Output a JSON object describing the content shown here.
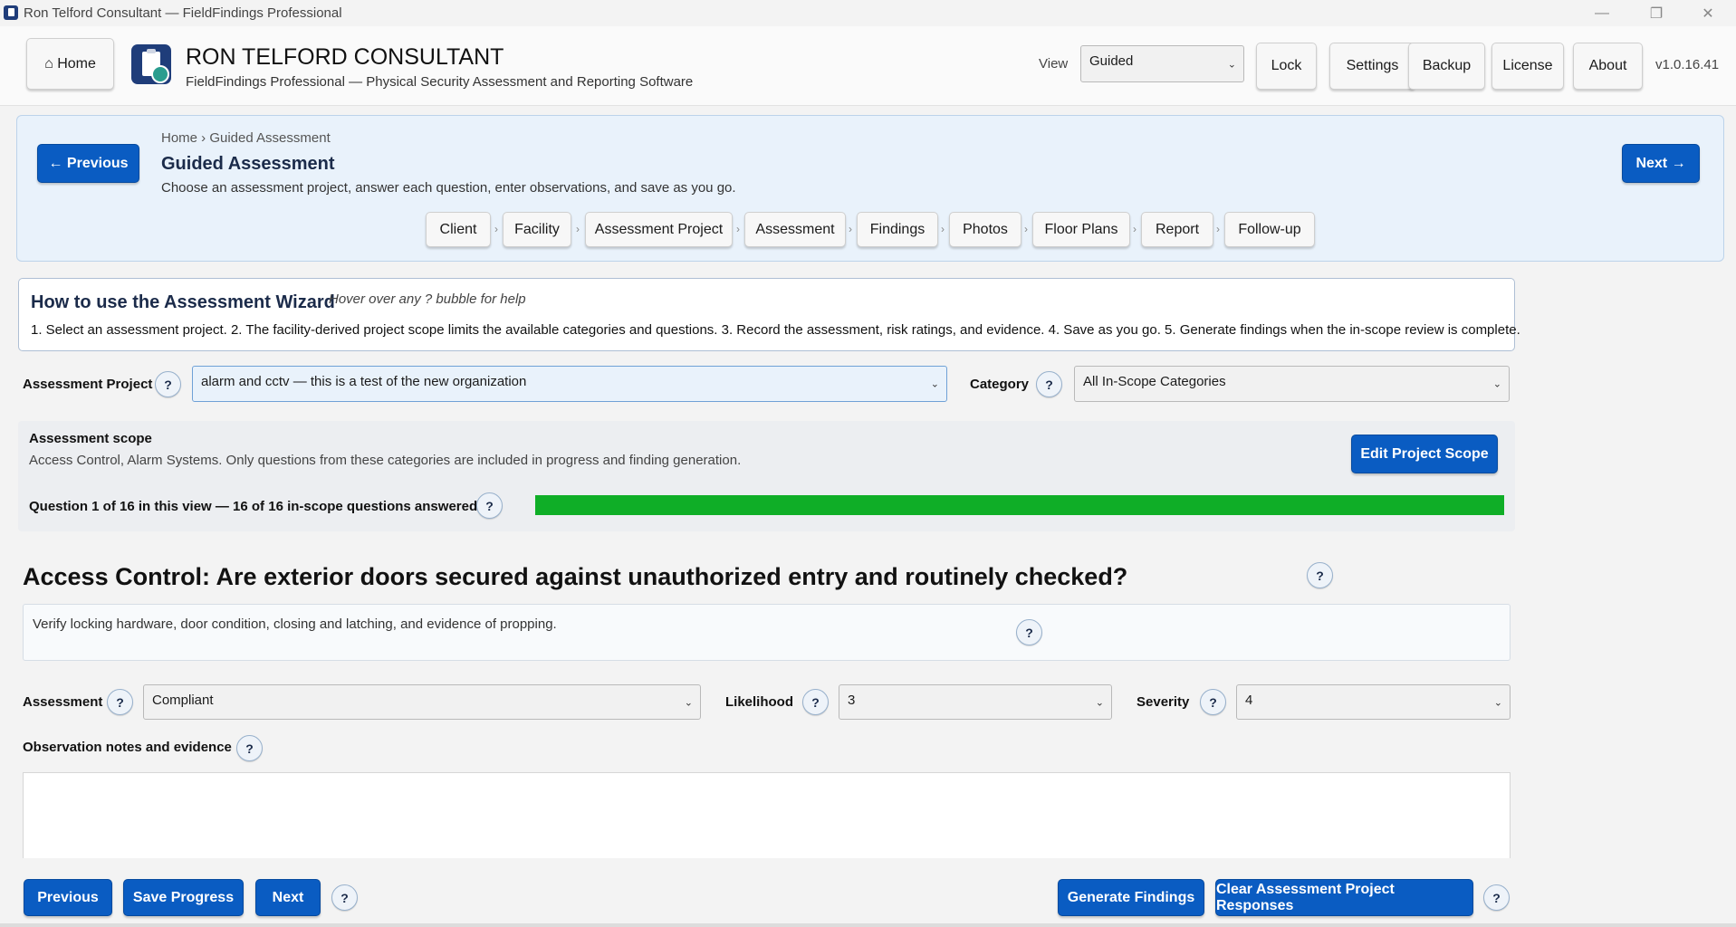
{
  "window": {
    "title": "Ron Telford Consultant — FieldFindings Professional",
    "controls": {
      "minimize": "—",
      "restore": "❐",
      "close": "✕"
    }
  },
  "header": {
    "home_label": "⌂  Home",
    "app_name": "RON TELFORD CONSULTANT",
    "app_subtitle": "FieldFindings Professional — Physical Security Assessment and Reporting Software",
    "view_label": "View",
    "view_value": "Guided",
    "buttons": {
      "lock": "Lock",
      "settings": "Settings",
      "backup": "Backup",
      "license": "License",
      "about": "About"
    },
    "version": "v1.0.16.41"
  },
  "wizard": {
    "previous_label": "← Previous",
    "next_label": "Next →",
    "breadcrumb": "Home  ›  Guided Assessment",
    "title": "Guided Assessment",
    "description": "Choose an assessment project, answer each question, enter observations, and save as you go.",
    "steps": [
      "Client",
      "Facility",
      "Assessment Project",
      "Assessment",
      "Findings",
      "Photos",
      "Floor Plans",
      "Report",
      "Follow-up"
    ],
    "step_separator": "›"
  },
  "howto": {
    "title": "How to use the Assessment Wizard",
    "hint": "Hover over any ? bubble for help",
    "steps": "1. Select an assessment project.  2. The facility-derived project scope limits the available categories and questions.  3. Record the assessment, risk ratings, and evidence.  4. Save as you go.  5. Generate findings when the in-scope review is complete."
  },
  "help_glyph": "?",
  "assessment_project": {
    "label": "Assessment Project",
    "value": "alarm and cctv — this is a test of the new organization"
  },
  "category": {
    "label": "Category",
    "value": "All In-Scope Categories"
  },
  "scope": {
    "title": "Assessment scope",
    "description": "Access Control, Alarm Systems. Only questions from these categories are included in progress and finding generation.",
    "edit_label": "Edit Project Scope",
    "progress_text": "Question 1 of 16 in this view — 16 of 16 in-scope questions answered",
    "progress_fraction": 1.0,
    "progress_color": "#0fae27"
  },
  "question": {
    "text": "Access Control: Are exterior doors secured against unauthorized entry and routinely checked?",
    "guidance": "Verify locking hardware, door condition, closing and latching, and evidence of propping."
  },
  "ratings": {
    "assessment_label": "Assessment",
    "assessment_value": "Compliant",
    "likelihood_label": "Likelihood",
    "likelihood_value": "3",
    "severity_label": "Severity",
    "severity_value": "4"
  },
  "observation": {
    "label": "Observation notes and evidence",
    "value": ""
  },
  "footer": {
    "previous_label": "Previous",
    "save_label": "Save Progress",
    "next_label": "Next",
    "generate_label": "Generate Findings",
    "clear_label": "Clear Assessment Project Responses"
  },
  "colors": {
    "primary": "#0a5cc2",
    "panel_bg": "#e9f2fb",
    "progress": "#0fae27"
  }
}
